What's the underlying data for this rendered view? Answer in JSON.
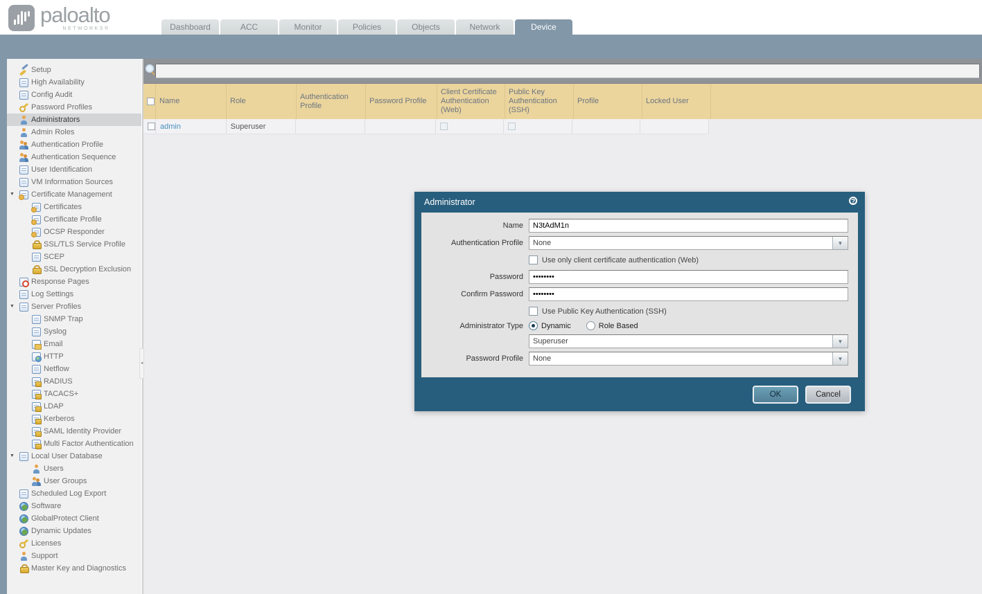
{
  "brand": {
    "logo_word": "paloalto",
    "logo_sub": "NETWORKS®"
  },
  "nav": {
    "tabs": [
      {
        "label": "Dashboard",
        "active": false
      },
      {
        "label": "ACC",
        "active": false
      },
      {
        "label": "Monitor",
        "active": false
      },
      {
        "label": "Policies",
        "active": false
      },
      {
        "label": "Objects",
        "active": false
      },
      {
        "label": "Network",
        "active": false
      },
      {
        "label": "Device",
        "active": true
      }
    ]
  },
  "sidebar": {
    "items": [
      {
        "label": "Setup",
        "icon": "wrench-icon",
        "indent": 0
      },
      {
        "label": "High Availability",
        "icon": "ha-servers-icon",
        "indent": 0
      },
      {
        "label": "Config Audit",
        "icon": "config-audit-icon",
        "indent": 0
      },
      {
        "label": "Password Profiles",
        "icon": "key-icon",
        "indent": 0
      },
      {
        "label": "Administrators",
        "icon": "admin-user-icon",
        "indent": 0,
        "selected": true
      },
      {
        "label": "Admin Roles",
        "icon": "admin-roles-icon",
        "indent": 0
      },
      {
        "label": "Authentication Profile",
        "icon": "auth-profile-icon",
        "indent": 0
      },
      {
        "label": "Authentication Sequence",
        "icon": "auth-sequence-icon",
        "indent": 0
      },
      {
        "label": "User Identification",
        "icon": "user-id-icon",
        "indent": 0
      },
      {
        "label": "VM Information Sources",
        "icon": "vm-info-icon",
        "indent": 0
      },
      {
        "label": "Certificate Management",
        "icon": "certificate-folder-icon",
        "indent": 0,
        "expanded": true
      },
      {
        "label": "Certificates",
        "icon": "certificate-icon",
        "indent": 1
      },
      {
        "label": "Certificate Profile",
        "icon": "certificate-profile-icon",
        "indent": 1
      },
      {
        "label": "OCSP Responder",
        "icon": "ocsp-icon",
        "indent": 1
      },
      {
        "label": "SSL/TLS Service Profile",
        "icon": "ssl-lock-icon",
        "indent": 1
      },
      {
        "label": "SCEP",
        "icon": "scep-icon",
        "indent": 1
      },
      {
        "label": "SSL Decryption Exclusion",
        "icon": "ssl-exclusion-lock-icon",
        "indent": 1
      },
      {
        "label": "Response Pages",
        "icon": "response-pages-icon",
        "indent": 0
      },
      {
        "label": "Log Settings",
        "icon": "log-settings-icon",
        "indent": 0
      },
      {
        "label": "Server Profiles",
        "icon": "server-folder-icon",
        "indent": 0,
        "expanded": true
      },
      {
        "label": "SNMP Trap",
        "icon": "snmp-server-icon",
        "indent": 1
      },
      {
        "label": "Syslog",
        "icon": "syslog-server-icon",
        "indent": 1
      },
      {
        "label": "Email",
        "icon": "email-icon",
        "indent": 1
      },
      {
        "label": "HTTP",
        "icon": "http-icon",
        "indent": 1
      },
      {
        "label": "Netflow",
        "icon": "netflow-server-icon",
        "indent": 1
      },
      {
        "label": "RADIUS",
        "icon": "radius-server-lock-icon",
        "indent": 1
      },
      {
        "label": "TACACS+",
        "icon": "tacacs-server-lock-icon",
        "indent": 1
      },
      {
        "label": "LDAP",
        "icon": "ldap-server-lock-icon",
        "indent": 1
      },
      {
        "label": "Kerberos",
        "icon": "kerberos-server-lock-icon",
        "indent": 1
      },
      {
        "label": "SAML Identity Provider",
        "icon": "saml-server-lock-icon",
        "indent": 1
      },
      {
        "label": "Multi Factor Authentication",
        "icon": "mfa-icon",
        "indent": 1
      },
      {
        "label": "Local User Database",
        "icon": "user-db-icon",
        "indent": 0,
        "expanded": true
      },
      {
        "label": "Users",
        "icon": "user-icon",
        "indent": 1
      },
      {
        "label": "User Groups",
        "icon": "user-group-icon",
        "indent": 1
      },
      {
        "label": "Scheduled Log Export",
        "icon": "log-export-icon",
        "indent": 0
      },
      {
        "label": "Software",
        "icon": "software-globe-icon",
        "indent": 0
      },
      {
        "label": "GlobalProtect Client",
        "icon": "globalprotect-icon",
        "indent": 0
      },
      {
        "label": "Dynamic Updates",
        "icon": "dynamic-updates-icon",
        "indent": 0
      },
      {
        "label": "Licenses",
        "icon": "license-key-icon",
        "indent": 0
      },
      {
        "label": "Support",
        "icon": "support-icon",
        "indent": 0
      },
      {
        "label": "Master Key and Diagnostics",
        "icon": "master-key-icon",
        "indent": 0
      }
    ]
  },
  "toolbar": {
    "search_value": ""
  },
  "table": {
    "columns": [
      "",
      "Name",
      "Role",
      "Authentication Profile",
      "Password Profile",
      "Client Certificate Authentication (Web)",
      "Public Key Authentication (SSH)",
      "Profile",
      "Locked User"
    ],
    "rows": [
      {
        "name": "admin",
        "role": "Superuser",
        "authentication_profile": "",
        "password_profile": "",
        "client_cert_auth_web": false,
        "public_key_auth_ssh": false,
        "profile": "",
        "locked_user": ""
      }
    ]
  },
  "dialog": {
    "title": "Administrator",
    "help_glyph": "?",
    "name_label": "Name",
    "name_value": "N3tAdM1n",
    "auth_profile_label": "Authentication Profile",
    "auth_profile_value": "None",
    "client_cert_checkbox_label": "Use only client certificate authentication (Web)",
    "client_cert_checked": false,
    "password_label": "Password",
    "password_value": "••••••••",
    "confirm_password_label": "Confirm Password",
    "confirm_password_value": "••••••••",
    "public_key_checkbox_label": "Use Public Key Authentication (SSH)",
    "public_key_checked": false,
    "admin_type_label": "Administrator Type",
    "admin_type_options": [
      {
        "label": "Dynamic",
        "selected": true
      },
      {
        "label": "Role Based",
        "selected": false
      }
    ],
    "role_value": "Superuser",
    "password_profile_label": "Password Profile",
    "password_profile_value": "None",
    "ok_label": "OK",
    "cancel_label": "Cancel"
  },
  "colors": {
    "band": "#8297a8",
    "table_header": "#ebd59d",
    "dialog_chrome": "#285e7d",
    "ok_button": "#5d95ac",
    "link": "#4a8fc0"
  }
}
